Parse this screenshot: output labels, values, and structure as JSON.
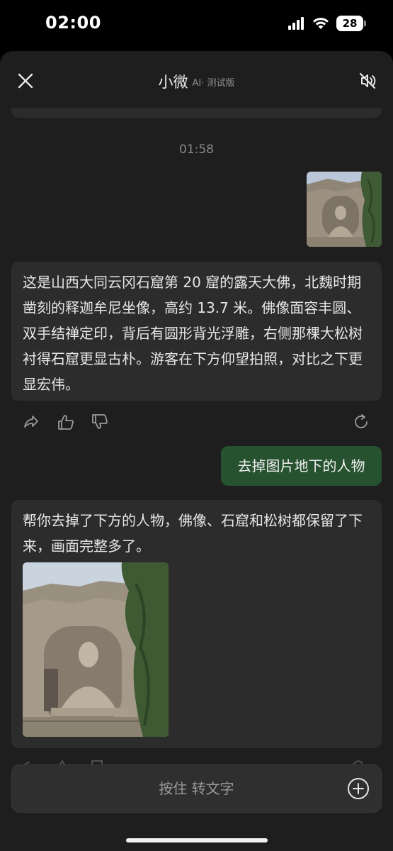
{
  "status_bar": {
    "time": "02:00",
    "battery_level": "28"
  },
  "nav": {
    "title": "小微",
    "subtitle": "AI· 测试版",
    "close_icon": "close-icon",
    "mute_icon": "speaker-muted-icon"
  },
  "chat": {
    "timestamp": "01:58",
    "messages": [
      {
        "role": "user",
        "type": "image",
        "image_desc_icon": "photo-thumbnail"
      },
      {
        "role": "assistant",
        "text": "这是山西大同云冈石窟第 20 窟的露天大佛，北魏时期凿刻的释迦牟尼坐像，高约 13.7 米。佛像面容丰圆、双手结禅定印，背后有圆形背光浮雕，右侧那棵大松树衬得石窟更显古朴。游客在下方仰望拍照，对比之下更显宏伟。"
      },
      {
        "role": "user",
        "type": "text",
        "text": "去掉图片地下的人物"
      },
      {
        "role": "assistant",
        "text": "帮你去掉了下方的人物，佛像、石窟和松树都保留了下来，画面完整多了。",
        "has_image": true
      }
    ],
    "action_icons": [
      "share-icon",
      "thumbs-up-icon",
      "thumbs-down-icon",
      "regenerate-icon"
    ]
  },
  "input": {
    "hold_to_talk_label": "按住 转文字",
    "plus_icon": "plus-circle-icon"
  },
  "colors": {
    "background": "#1e1e1e",
    "ai_bubble": "#2c2c2c",
    "user_bubble": "#26522f",
    "muted_text": "#8a8a8a"
  }
}
